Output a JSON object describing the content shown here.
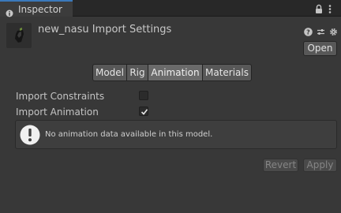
{
  "window": {
    "tab_title": "Inspector"
  },
  "header": {
    "title": "new_nasu Import Settings",
    "open_label": "Open"
  },
  "tabs": [
    {
      "label": "Model",
      "active": false
    },
    {
      "label": "Rig",
      "active": false
    },
    {
      "label": "Animation",
      "active": true
    },
    {
      "label": "Materials",
      "active": false
    }
  ],
  "settings": {
    "import_constraints": {
      "label": "Import Constraints",
      "checked": false
    },
    "import_animation": {
      "label": "Import Animation",
      "checked": true
    }
  },
  "helpbox": {
    "message": "No animation data available in this model."
  },
  "footer": {
    "revert_label": "Revert",
    "apply_label": "Apply"
  },
  "colors": {
    "background": "#383838",
    "tab_accent": "#3a79bb",
    "active_tab": "#6a6a6a"
  }
}
